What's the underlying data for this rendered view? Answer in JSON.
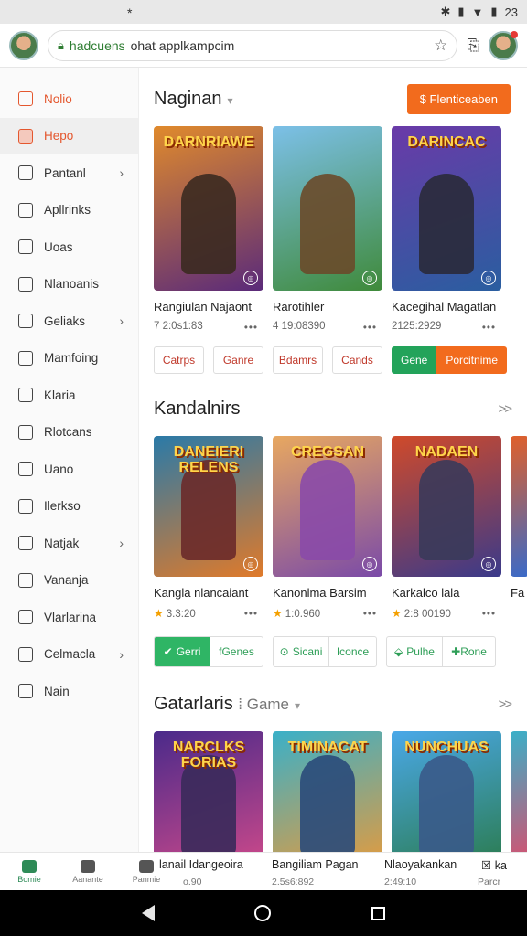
{
  "status": {
    "clock": "23",
    "star": "*"
  },
  "browser": {
    "url_domain": "hadcuens",
    "url_path": "ohat applkampcim"
  },
  "sidebar": {
    "items": [
      {
        "label": "Nolio",
        "chevron": false,
        "state": "accent"
      },
      {
        "label": "Hepo",
        "chevron": false,
        "state": "active"
      },
      {
        "label": "Pantanl",
        "chevron": true,
        "state": ""
      },
      {
        "label": "Apllrinks",
        "chevron": false,
        "state": ""
      },
      {
        "label": "Uoas",
        "chevron": false,
        "state": ""
      },
      {
        "label": "Nlanoanis",
        "chevron": false,
        "state": ""
      },
      {
        "label": "Geliaks",
        "chevron": true,
        "state": ""
      },
      {
        "label": "Mamfoing",
        "chevron": false,
        "state": ""
      },
      {
        "label": "Klaria",
        "chevron": false,
        "state": ""
      },
      {
        "label": "Rlotcans",
        "chevron": false,
        "state": ""
      },
      {
        "label": "Uano",
        "chevron": false,
        "state": ""
      },
      {
        "label": "Ilerkso",
        "chevron": false,
        "state": ""
      },
      {
        "label": "Natjak",
        "chevron": true,
        "state": ""
      },
      {
        "label": "Vananja",
        "chevron": false,
        "state": ""
      },
      {
        "label": "Vlarlarina",
        "chevron": false,
        "state": ""
      },
      {
        "label": "Celmacla",
        "chevron": true,
        "state": ""
      },
      {
        "label": "Nain",
        "chevron": false,
        "state": ""
      }
    ]
  },
  "section1": {
    "title": "Naginan",
    "action": "$ Flenticeaben",
    "cards": [
      {
        "art": "DARNRIAWE",
        "name": "Rangiulan Najaont",
        "meta": "7 2:0s1:83",
        "colors": [
          "#e08a2c",
          "#5a2a7a"
        ],
        "hero": "#3b2a20"
      },
      {
        "art": "",
        "name": "Rarotihler",
        "meta": "4 19:08390",
        "colors": [
          "#7cc0e8",
          "#3f8a3a"
        ],
        "hero": "#6a4a2a"
      },
      {
        "art": "DARINCAC",
        "name": "Kacegihal Magatlan",
        "meta": "2125:2929",
        "colors": [
          "#6a3aa8",
          "#2a5ea0"
        ],
        "hero": "#2a2a3a"
      }
    ],
    "buttons": [
      "Catrps",
      "Ganre",
      "Bdamrs",
      "Cands"
    ],
    "split_button": {
      "green": "Gene",
      "orange": "Porcitnime"
    }
  },
  "section2": {
    "title": "Kandalnirs",
    "cards": [
      {
        "art": "DANEIERI RELENS",
        "name": "Kangla nlancaiant",
        "meta": "3.3:20",
        "colors": [
          "#2a7aa8",
          "#e07a2a"
        ],
        "hero": "#6a2a2a"
      },
      {
        "art": "CREGSAN",
        "name": "Kanonlma Barsim",
        "meta": "1:0.960",
        "colors": [
          "#e8a860",
          "#7a4aa8"
        ],
        "hero": "#8a4aa8"
      },
      {
        "art": "NADAEN",
        "name": "Karkalco lala",
        "meta": "2:8 00190",
        "colors": [
          "#d04a2a",
          "#3a3a8a"
        ],
        "hero": "#3a3a5a"
      }
    ],
    "pairs": [
      {
        "a": "Gerri",
        "b": "fGenes"
      },
      {
        "a": "Sicani",
        "b": "Iconce"
      },
      {
        "a": "Pulhe",
        "b": "Rone"
      }
    ],
    "partial_name": "Fa"
  },
  "section3": {
    "title": "Gatarlaris",
    "sub": "Game",
    "cards": [
      {
        "art": "NARCLKS FORIAS",
        "colors": [
          "#4a2a8a",
          "#d04a8a"
        ],
        "hero": "#3a2a5a"
      },
      {
        "art": "TIMINACAT",
        "colors": [
          "#3ab0c8",
          "#e89a3a"
        ],
        "hero": "#2a4a7a"
      },
      {
        "art": "NUNCHUAS",
        "colors": [
          "#4aa8e8",
          "#2a7a4a"
        ],
        "hero": "#3a5a8a"
      }
    ]
  },
  "bottom_nav": {
    "items": [
      {
        "label": "Bomie",
        "active": true
      },
      {
        "label": "Aanante",
        "active": false
      },
      {
        "label": "Panmie",
        "active": false
      }
    ],
    "cards": [
      {
        "name": "lanail Idangeoira",
        "meta": "o.90"
      },
      {
        "name": "Bangiliam Pagan",
        "meta": "2.5s6:892"
      },
      {
        "name": "Nlaoyakankan",
        "meta": "2:49:10"
      }
    ],
    "right": {
      "label": "Parcr",
      "text": "ka"
    }
  }
}
